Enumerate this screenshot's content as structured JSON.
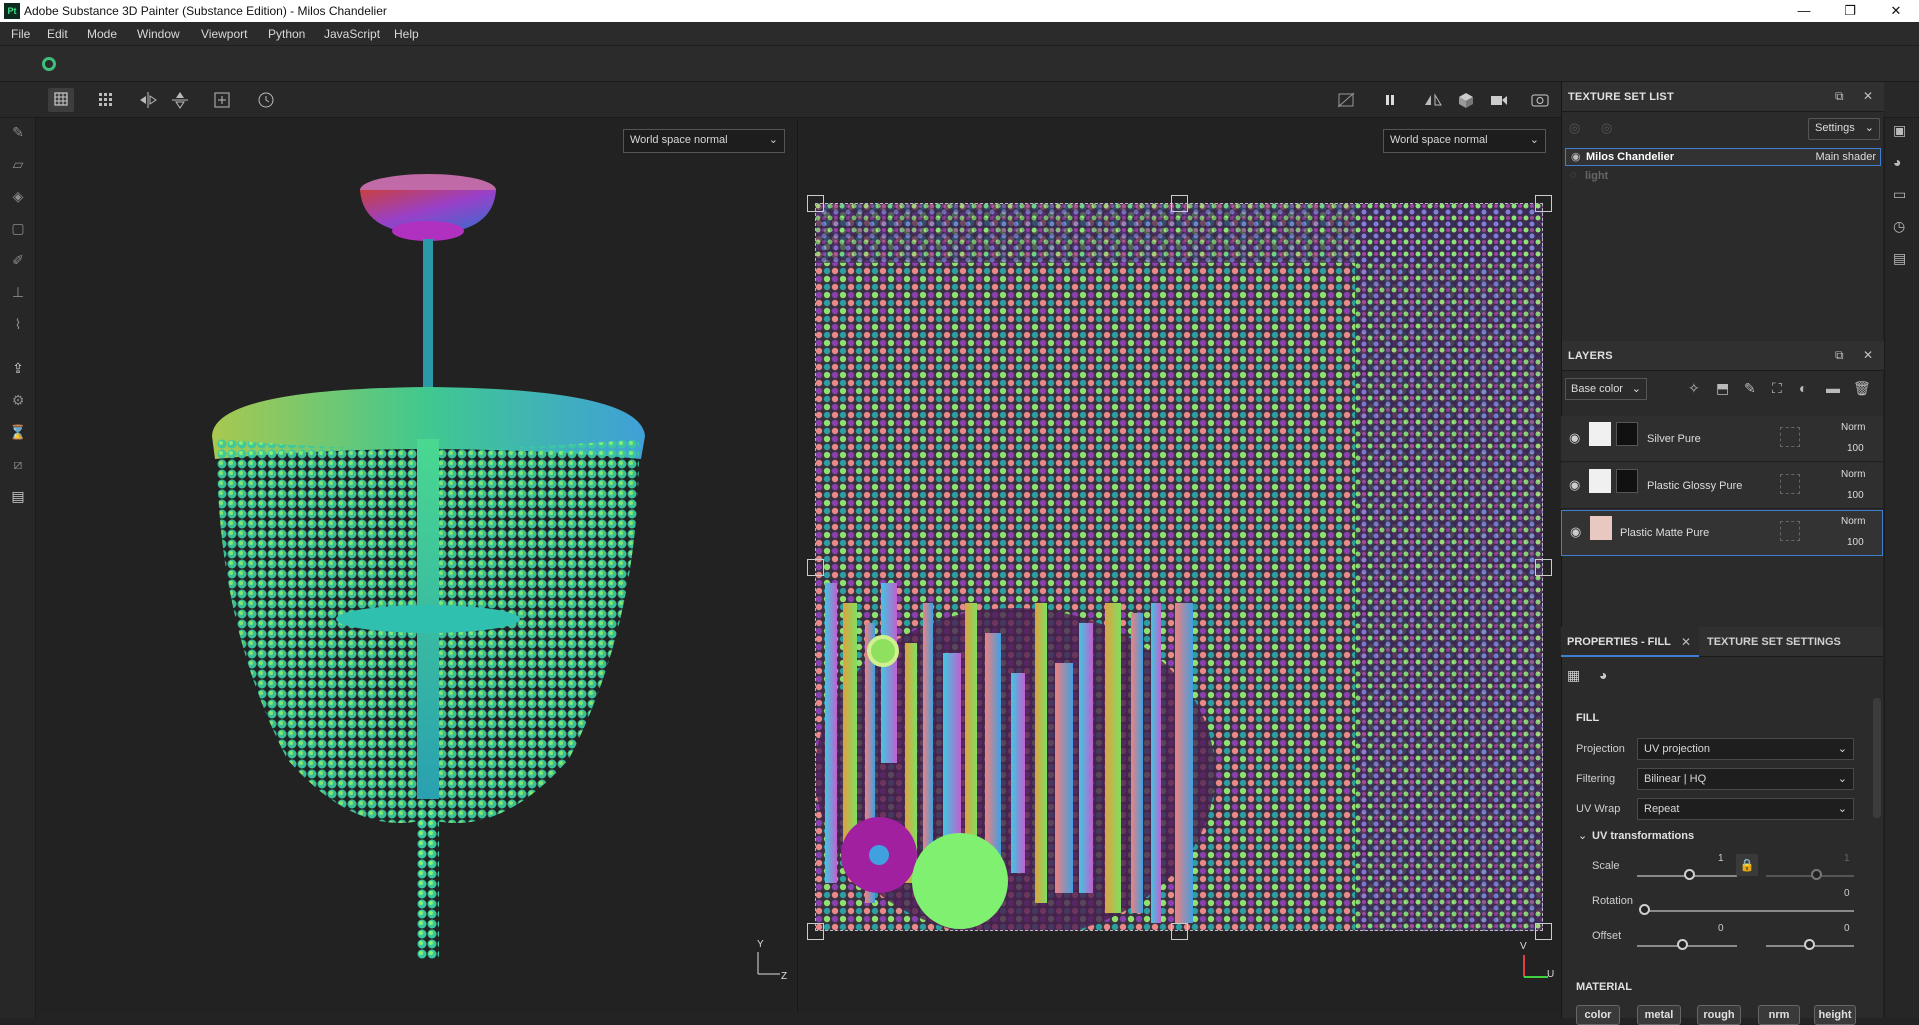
{
  "window": {
    "title": "Adobe Substance 3D Painter (Substance Edition) - Milos Chandelier",
    "app_icon": "Pt",
    "controls": [
      "—",
      "❐",
      "✕"
    ]
  },
  "menu": [
    "File",
    "Edit",
    "Mode",
    "Window",
    "Viewport",
    "Python",
    "JavaScript",
    "Help"
  ],
  "viewport3d": {
    "channel": "World space normal",
    "axis_y": "Y",
    "axis_z": "Z"
  },
  "viewport2d": {
    "channel": "World space normal",
    "axis_v": "V",
    "axis_u": "U"
  },
  "texture_set_list": {
    "title": "TEXTURE SET LIST",
    "settings_label": "Settings",
    "items": [
      {
        "name": "Milos Chandelier",
        "shader": "Main shader",
        "selected": true
      },
      {
        "name": "light",
        "shader": "",
        "selected": false
      }
    ]
  },
  "layers": {
    "title": "LAYERS",
    "channel": "Base color",
    "items": [
      {
        "name": "Silver Pure",
        "blend": "Norm",
        "opacity": "100"
      },
      {
        "name": "Plastic Glossy Pure",
        "blend": "Norm",
        "opacity": "100"
      },
      {
        "name": "Plastic Matte Pure",
        "blend": "Norm",
        "opacity": "100"
      }
    ]
  },
  "properties": {
    "tab_fill": "PROPERTIES - FILL",
    "tab_texture_set": "TEXTURE SET SETTINGS",
    "section_fill": "FILL",
    "projection_label": "Projection",
    "projection_value": "UV projection",
    "filtering_label": "Filtering",
    "filtering_value": "Bilinear | HQ",
    "uvwrap_label": "UV Wrap",
    "uvwrap_value": "Repeat",
    "uv_transformations": "UV transformations",
    "scale_label": "Scale",
    "scale_value": "1",
    "scale_value2": "1",
    "rotation_label": "Rotation",
    "rotation_value": "0",
    "offset_label": "Offset",
    "offset_value_u": "0",
    "offset_value_v": "0",
    "section_material": "MATERIAL",
    "material_chips": [
      "color",
      "metal",
      "rough",
      "nrm",
      "height"
    ]
  },
  "colors": {
    "accent_blue": "#3f7fd0",
    "panel_bg": "#2b2b2b",
    "viewport_bg": "#222222"
  }
}
